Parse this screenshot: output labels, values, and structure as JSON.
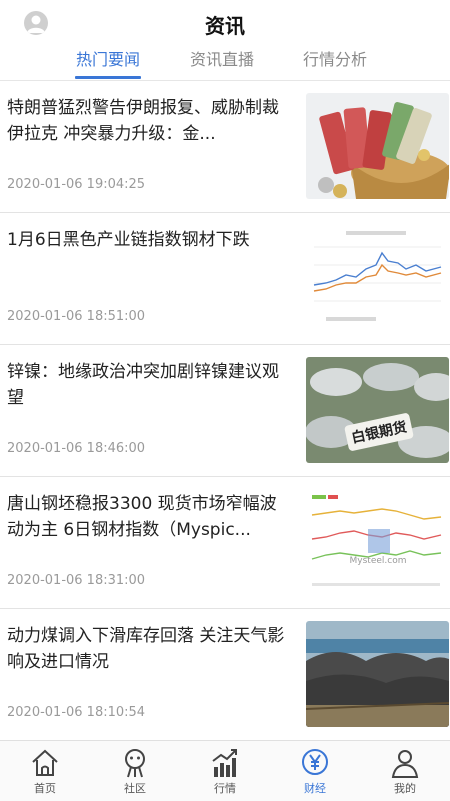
{
  "header": {
    "title": "资讯",
    "tabs": [
      {
        "label": "热门要闻"
      },
      {
        "label": "资讯直播"
      },
      {
        "label": "行情分析"
      }
    ],
    "active_tab": 0
  },
  "news": [
    {
      "title": "特朗普猛烈警告伊朗报复、威胁制裁伊拉克 冲突暴力升级：金...",
      "time": "2020-01-06 19:04:25",
      "thumbnail": "money-basket-image"
    },
    {
      "title": "1月6日黑色产业链指数钢材下跌",
      "time": "2020-01-06 18:51:00",
      "thumbnail": "line-chart-image"
    },
    {
      "title": "锌镍：地缘政治冲突加剧锌镍建议观望",
      "time": "2020-01-06 18:46:00",
      "thumbnail": "silver-ingots-image",
      "thumbnail_text": "白银期货"
    },
    {
      "title": "唐山钢坯稳报3300 现货市场窄幅波动为主 6日钢材指数（Myspic...",
      "time": "2020-01-06 18:31:00",
      "thumbnail": "steel-index-chart-image",
      "thumbnail_text": "Mysteel.com"
    },
    {
      "title": "动力煤调入下滑库存回落 关注天气影响及进口情况",
      "time": "2020-01-06 18:10:54",
      "thumbnail": "coal-port-image"
    }
  ],
  "tabbar": {
    "items": [
      {
        "label": "首页",
        "icon": "home-icon"
      },
      {
        "label": "社区",
        "icon": "community-icon"
      },
      {
        "label": "行情",
        "icon": "market-chart-icon"
      },
      {
        "label": "财经",
        "icon": "finance-yen-icon"
      },
      {
        "label": "我的",
        "icon": "profile-icon"
      }
    ],
    "active": 3
  },
  "colors": {
    "accent": "#3a76d6",
    "muted": "#9a9a9a"
  }
}
